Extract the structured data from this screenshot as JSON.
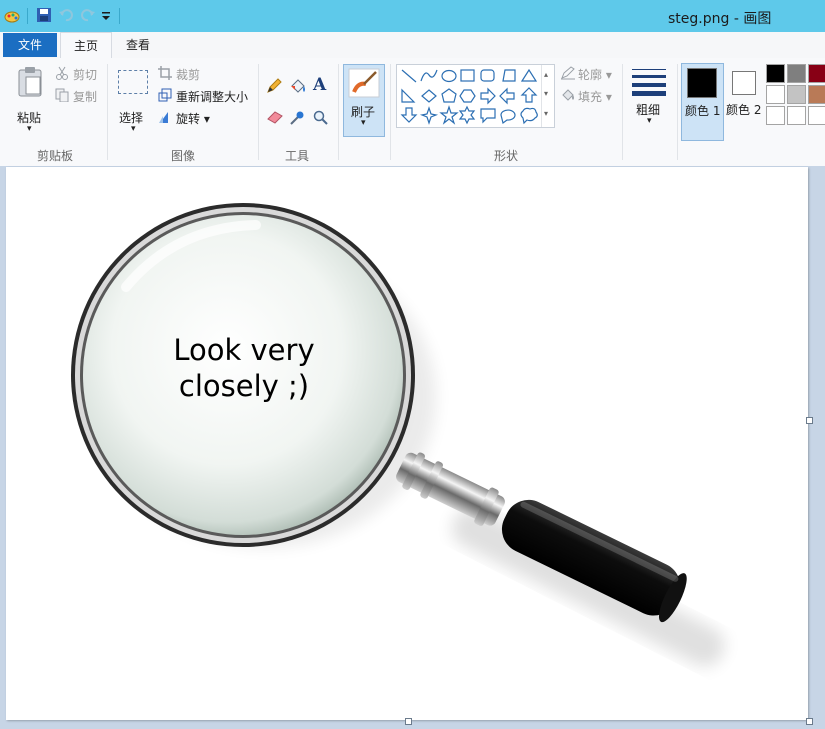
{
  "window": {
    "title": "steg.png - 画图"
  },
  "tabs": {
    "file": "文件",
    "home": "主页",
    "view": "查看"
  },
  "clipboard": {
    "paste": "粘贴",
    "cut": "剪切",
    "copy": "复制",
    "group": "剪贴板"
  },
  "image": {
    "select": "选择",
    "crop": "裁剪",
    "resize": "重新调整大小",
    "rotate": "旋转",
    "group": "图像"
  },
  "tools": {
    "group": "工具"
  },
  "brush": {
    "label": "刷子"
  },
  "shapes": {
    "outline": "轮廓",
    "fill": "填充",
    "group": "形状"
  },
  "size": {
    "label": "粗细"
  },
  "colors": {
    "color1": "颜色 1",
    "color2": "颜色 2",
    "color1_value": "#000000",
    "color2_value": "#ffffff",
    "palette_row1": [
      "#000000",
      "#7f7f7f",
      "#880015"
    ],
    "palette_row2": [
      "#ffffff",
      "#c3c3c3",
      "#b97a57"
    ],
    "palette_row3": [
      "#ffffff",
      "#ffffff",
      "#ffffff"
    ]
  },
  "canvas": {
    "text": [
      "Look very",
      "closely ;)"
    ]
  }
}
